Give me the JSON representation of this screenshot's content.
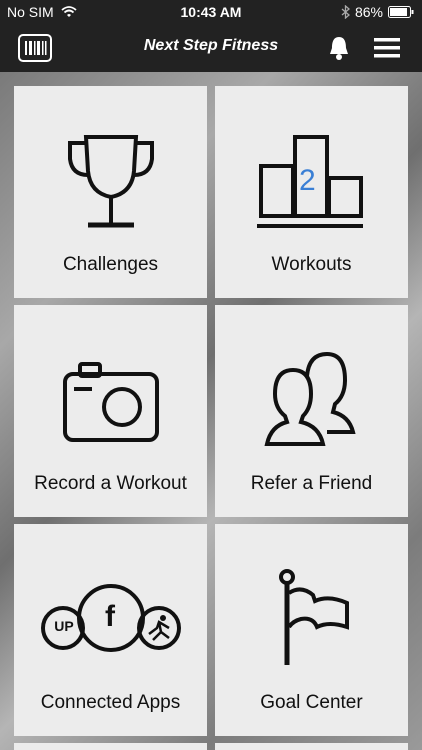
{
  "status_bar": {
    "carrier": "No SIM",
    "time": "10:43 AM",
    "battery": "86%"
  },
  "nav": {
    "title": "Next Step Fitness"
  },
  "tiles": [
    {
      "label": "Challenges",
      "icon": "trophy-icon"
    },
    {
      "label": "Workouts",
      "icon": "podium-icon",
      "badge": "2"
    },
    {
      "label": "Record a Workout",
      "icon": "camera-icon"
    },
    {
      "label": "Refer a Friend",
      "icon": "users-icon"
    },
    {
      "label": "Connected Apps",
      "icon": "connected-apps-icon",
      "logos": [
        "UP",
        "f"
      ]
    },
    {
      "label": "Goal Center",
      "icon": "flag-icon"
    }
  ],
  "colors": {
    "bar": "#222222",
    "tile": "#ececec",
    "accent": "#3a7fd5"
  }
}
